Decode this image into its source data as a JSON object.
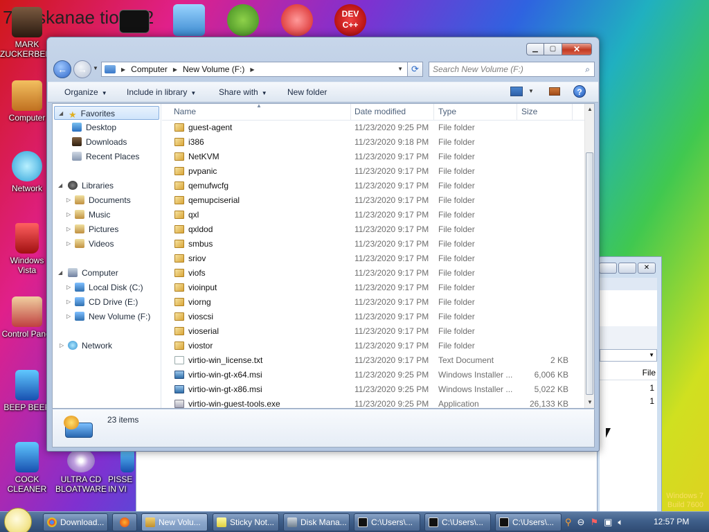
{
  "desktop": {
    "banner": "7 osskanae tio 012",
    "icons": [
      {
        "label": "MARK ZUCKERBERG"
      },
      {
        "label": "Computer"
      },
      {
        "label": "Network"
      },
      {
        "label": "Windows Vista"
      },
      {
        "label": "Control Panel"
      },
      {
        "label": "BEEP BEEP"
      },
      {
        "label": "COCK CLEANER"
      },
      {
        "label": "ULTRA CD BLOATWARE"
      },
      {
        "label": "PISSE IN VI"
      }
    ],
    "top_icons": [
      {
        "label": "DEV C++"
      }
    ],
    "watermark_line1": "Windows 7",
    "watermark_line2": "Build 7600"
  },
  "explorer": {
    "address": {
      "crumbs": [
        "Computer",
        "New Volume (F:)"
      ]
    },
    "search_placeholder": "Search New Volume (F:)",
    "toolbar": {
      "organize": "Organize",
      "include": "Include in library",
      "share": "Share with",
      "new_folder": "New folder"
    },
    "nav": {
      "favorites": "Favorites",
      "desktop": "Desktop",
      "downloads": "Downloads",
      "recent": "Recent Places",
      "libraries": "Libraries",
      "documents": "Documents",
      "music": "Music",
      "pictures": "Pictures",
      "videos": "Videos",
      "computer": "Computer",
      "local_disk": "Local Disk (C:)",
      "cd_drive": "CD Drive (E:)",
      "new_volume": "New Volume (F:)",
      "network": "Network"
    },
    "columns": {
      "name": "Name",
      "date": "Date modified",
      "type": "Type",
      "size": "Size"
    },
    "files": [
      {
        "name": "guest-agent",
        "date": "11/23/2020 9:25 PM",
        "type": "File folder",
        "size": "",
        "kind": "folder"
      },
      {
        "name": "i386",
        "date": "11/23/2020 9:18 PM",
        "type": "File folder",
        "size": "",
        "kind": "folder"
      },
      {
        "name": "NetKVM",
        "date": "11/23/2020 9:17 PM",
        "type": "File folder",
        "size": "",
        "kind": "folder"
      },
      {
        "name": "pvpanic",
        "date": "11/23/2020 9:17 PM",
        "type": "File folder",
        "size": "",
        "kind": "folder"
      },
      {
        "name": "qemufwcfg",
        "date": "11/23/2020 9:17 PM",
        "type": "File folder",
        "size": "",
        "kind": "folder"
      },
      {
        "name": "qemupciserial",
        "date": "11/23/2020 9:17 PM",
        "type": "File folder",
        "size": "",
        "kind": "folder"
      },
      {
        "name": "qxl",
        "date": "11/23/2020 9:17 PM",
        "type": "File folder",
        "size": "",
        "kind": "folder"
      },
      {
        "name": "qxldod",
        "date": "11/23/2020 9:17 PM",
        "type": "File folder",
        "size": "",
        "kind": "folder"
      },
      {
        "name": "smbus",
        "date": "11/23/2020 9:17 PM",
        "type": "File folder",
        "size": "",
        "kind": "folder"
      },
      {
        "name": "sriov",
        "date": "11/23/2020 9:17 PM",
        "type": "File folder",
        "size": "",
        "kind": "folder"
      },
      {
        "name": "viofs",
        "date": "11/23/2020 9:17 PM",
        "type": "File folder",
        "size": "",
        "kind": "folder"
      },
      {
        "name": "vioinput",
        "date": "11/23/2020 9:17 PM",
        "type": "File folder",
        "size": "",
        "kind": "folder"
      },
      {
        "name": "viorng",
        "date": "11/23/2020 9:17 PM",
        "type": "File folder",
        "size": "",
        "kind": "folder"
      },
      {
        "name": "vioscsi",
        "date": "11/23/2020 9:17 PM",
        "type": "File folder",
        "size": "",
        "kind": "folder"
      },
      {
        "name": "vioserial",
        "date": "11/23/2020 9:17 PM",
        "type": "File folder",
        "size": "",
        "kind": "folder"
      },
      {
        "name": "viostor",
        "date": "11/23/2020 9:17 PM",
        "type": "File folder",
        "size": "",
        "kind": "folder"
      },
      {
        "name": "virtio-win_license.txt",
        "date": "11/23/2020 9:17 PM",
        "type": "Text Document",
        "size": "2 KB",
        "kind": "txt"
      },
      {
        "name": "virtio-win-gt-x64.msi",
        "date": "11/23/2020 9:25 PM",
        "type": "Windows Installer ...",
        "size": "6,006 KB",
        "kind": "msi"
      },
      {
        "name": "virtio-win-gt-x86.msi",
        "date": "11/23/2020 9:25 PM",
        "type": "Windows Installer ...",
        "size": "5,022 KB",
        "kind": "msi"
      },
      {
        "name": "virtio-win-guest-tools.exe",
        "date": "11/23/2020 9:25 PM",
        "type": "Application",
        "size": "26,133 KB",
        "kind": "exe"
      }
    ],
    "item_count": "23 items"
  },
  "background_window": {
    "col_label": "File",
    "val1": "1",
    "val2": "1"
  },
  "taskbar": {
    "buttons": [
      {
        "label": "Download..."
      },
      {
        "label": "New Volu..."
      },
      {
        "label": "Sticky Not..."
      },
      {
        "label": "Disk Mana..."
      },
      {
        "label": "C:\\Users\\..."
      },
      {
        "label": "C:\\Users\\..."
      },
      {
        "label": "C:\\Users\\..."
      }
    ],
    "clock": "12:57 PM"
  }
}
